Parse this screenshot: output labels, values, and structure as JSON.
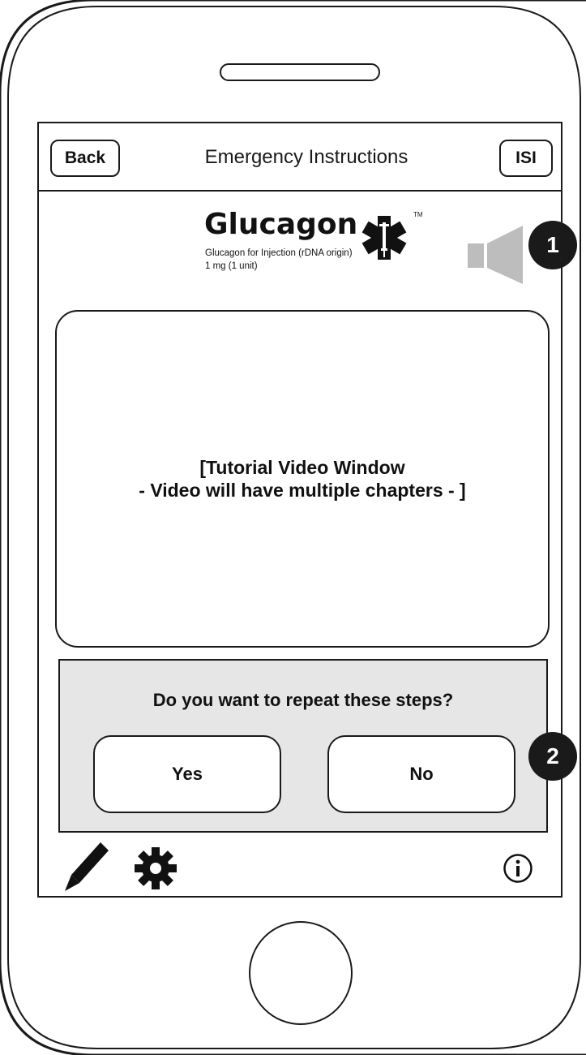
{
  "navbar": {
    "back_label": "Back",
    "title": "Emergency Instructions",
    "isi_label": "ISI"
  },
  "logo": {
    "wordmark": "Glucagon",
    "trademark": "TM",
    "subtitle_line1": "Glucagon for Injection (rDNA origin)",
    "subtitle_line2": "1 mg (1 unit)"
  },
  "video": {
    "line1": "[Tutorial Video Window",
    "line2": "- Video will have multiple chapters - ]"
  },
  "repeat_panel": {
    "question": "Do you want to repeat these steps?",
    "yes_label": "Yes",
    "no_label": "No"
  },
  "toolbar": {
    "icons": [
      "pen-icon",
      "gear-icon",
      "info-icon"
    ]
  },
  "callouts": {
    "badge1": "1",
    "badge2": "2"
  },
  "icons": {
    "volume": "speaker-icon"
  },
  "colors": {
    "outline": "#1a1a1a",
    "panel_bg": "#e6e6e6",
    "volume_gray": "#bdbdbd",
    "badge_bg": "#1a1a1a"
  }
}
